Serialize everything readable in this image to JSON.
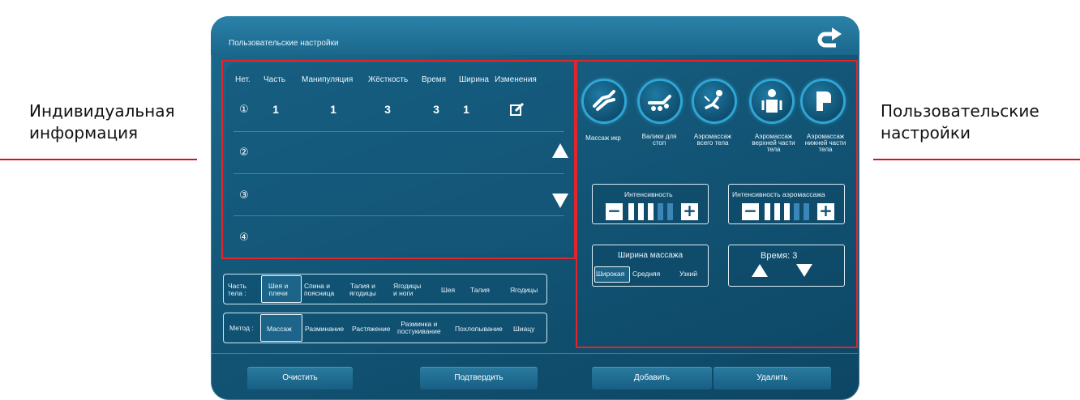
{
  "annotations": {
    "left": [
      "Индивидуальная",
      "информация"
    ],
    "right": [
      "Пользовательские",
      "настройки"
    ]
  },
  "header": {
    "title": "Пользовательские настройки",
    "back_icon": "return-arrow-icon"
  },
  "table": {
    "columns": [
      "Нет.",
      "Часть",
      "Манипуляция",
      "Жёсткость",
      "Время",
      "Ширина",
      "Изменения"
    ],
    "rows": [
      {
        "num": "①",
        "part": "1",
        "manipulation": "1",
        "stiffness": "3",
        "time": "3",
        "width": "1",
        "edit_icon": "edit-icon"
      },
      {
        "num": "②"
      },
      {
        "num": "③"
      },
      {
        "num": "④"
      }
    ]
  },
  "body_part": {
    "label": [
      "Часть",
      "тела :"
    ],
    "options": [
      [
        "Шея и",
        "плечи"
      ],
      [
        "Спина и",
        "поясница"
      ],
      [
        "Талия и",
        "ягодицы"
      ],
      [
        "Ягодицы",
        "и ноги"
      ],
      [
        "Шея"
      ],
      [
        "Талия"
      ],
      [
        "Ягодицы"
      ]
    ],
    "selected": 0
  },
  "method": {
    "label": "Метод :",
    "options": [
      [
        "Массаж"
      ],
      [
        "Разминание"
      ],
      [
        "Растяжение"
      ],
      [
        "Разминка и",
        "постукивание"
      ],
      [
        "Похлопывание"
      ],
      [
        "Шиацу"
      ]
    ],
    "selected": 0
  },
  "modes": [
    {
      "label": [
        "Массаж икр"
      ],
      "icon": "calf-massage-icon"
    },
    {
      "label": [
        "Валики для",
        "стоп"
      ],
      "icon": "foot-roller-icon"
    },
    {
      "label": [
        "Аэромассаж",
        "всего тела"
      ],
      "icon": "full-body-airbag-icon"
    },
    {
      "label": [
        "Аэромассаж",
        "верхней части",
        "тела"
      ],
      "icon": "upper-body-airbag-icon"
    },
    {
      "label": [
        "Аэромассаж",
        "нижней части",
        "тела"
      ],
      "icon": "lower-body-airbag-icon"
    }
  ],
  "intensity": {
    "title": "Интенсивность",
    "level": 3,
    "max": 5,
    "minus": "−",
    "plus": "+"
  },
  "air_intensity": {
    "title": "Интенсивность аэромассажа",
    "level": 3,
    "max": 5,
    "minus": "−",
    "plus": "+"
  },
  "massage_width": {
    "title": "Ширина массажа",
    "options": [
      "Широкая",
      "Средняя",
      "Узкий"
    ],
    "selected": 0
  },
  "time": {
    "label": "Время: 3",
    "up_icon": "up-triangle-icon",
    "down_icon": "down-triangle-icon"
  },
  "footer": {
    "clear": "Очистить",
    "confirm": "Подтвердить",
    "add": "Добавить",
    "delete": "Удалить"
  },
  "colors": {
    "accent_red": "#e0262b",
    "panel": "#135677",
    "level_on": "#ffffff",
    "level_off": "#3a86b8"
  }
}
